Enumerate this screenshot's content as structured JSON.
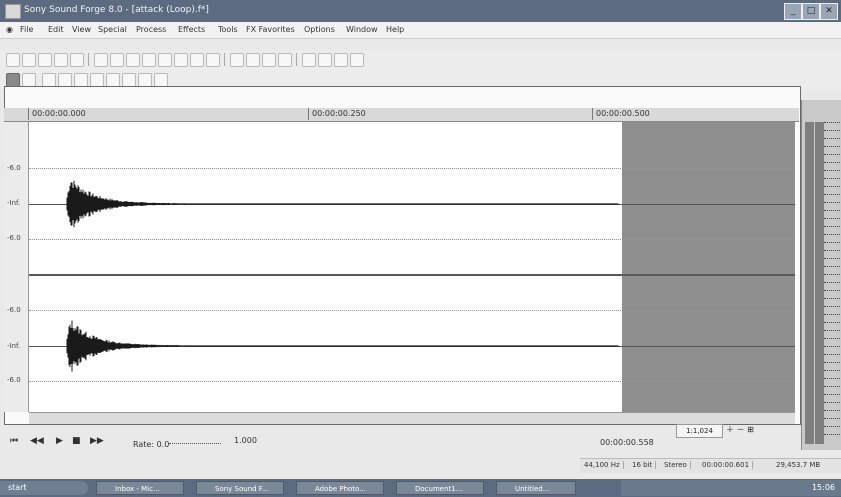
{
  "window": {
    "title": "Sony Sound Forge 8.0 - [attack (Loop).f*]"
  },
  "menu": [
    "File",
    "Edit",
    "View",
    "Special",
    "Process",
    "Effects",
    "Tools",
    "FX Favorites",
    "Options",
    "Window",
    "Help"
  ],
  "ruler": {
    "start": "00:00:00.000",
    "mid": "00:00:00.250",
    "end": "00:00:00.500"
  },
  "db_labels": [
    "-6.0",
    "-Inf.",
    "-6.0",
    "-6.0",
    "-Inf.",
    "-6.0"
  ],
  "transport": {
    "rate_label": "Rate: 0.0",
    "rate_value": "1.000",
    "position": "00:00:00.558",
    "zoom": "1:1,024"
  },
  "status": {
    "format": "44,100 Hz",
    "bits": "16 bit",
    "channels": "Stereo",
    "length": "00:00:00.601",
    "free": "29,453.7 MB"
  },
  "taskbar": {
    "start": "start",
    "tasks": [
      "Inbox - Mic...",
      "Sony Sound F...",
      "Adobe Photo...",
      "Document1...",
      "Untitled..."
    ],
    "clock": "15:06"
  },
  "colors": {
    "titlebar": "#5c6b7f",
    "selection": "#8f8f8f",
    "waveform": "#1a1a1a"
  }
}
